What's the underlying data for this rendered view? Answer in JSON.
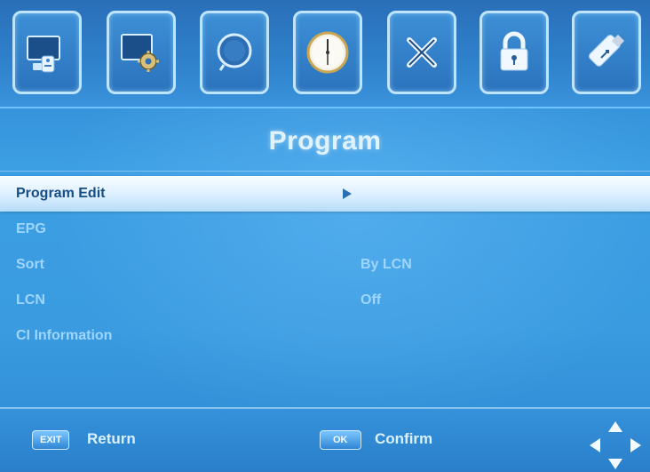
{
  "toolbar": {
    "icons": [
      "tv-remote-icon",
      "display-settings-icon",
      "search-icon",
      "clock-icon",
      "tools-icon",
      "lock-icon",
      "usb-icon"
    ]
  },
  "title": "Program",
  "menu": {
    "items": [
      {
        "label": "Program Edit",
        "value": "",
        "selected": true
      },
      {
        "label": "EPG",
        "value": ""
      },
      {
        "label": "Sort",
        "value": "By LCN"
      },
      {
        "label": "LCN",
        "value": "Off"
      },
      {
        "label": "CI Information",
        "value": ""
      }
    ]
  },
  "footer": {
    "exit_key": "EXIT",
    "exit_label": "Return",
    "ok_key": "OK",
    "ok_label": "Confirm"
  },
  "colors": {
    "accent": "#3a9be0",
    "selected_row": "#dcefff",
    "text": "#9fd6ff"
  }
}
